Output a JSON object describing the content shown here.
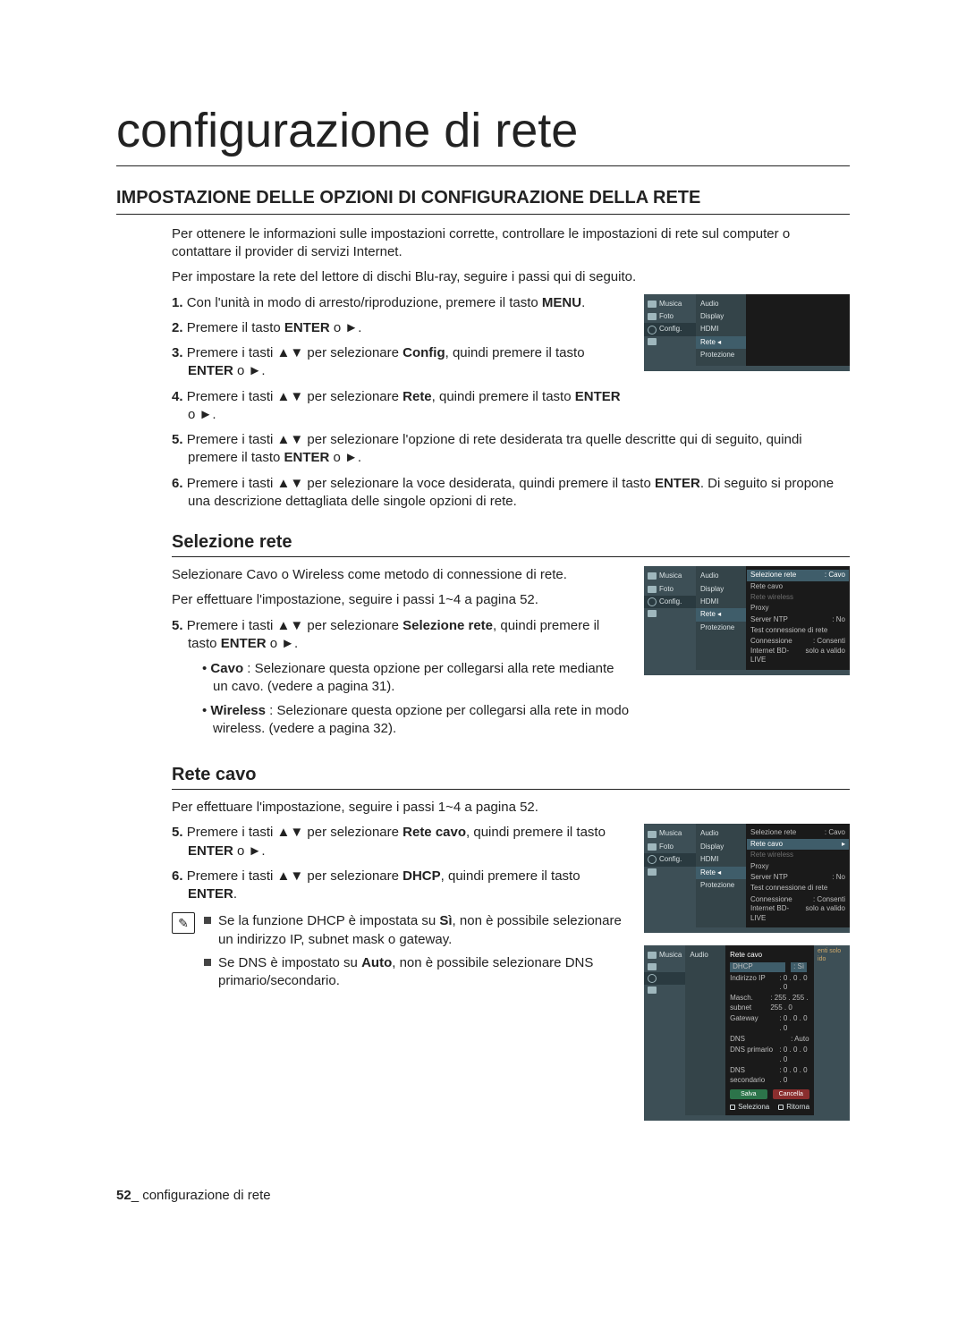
{
  "page_title": "configurazione di rete",
  "main_heading": "IMPOSTAZIONE DELLE OPZIONI DI CONFIGURAZIONE DELLA RETE",
  "intro_p1": "Per ottenere le informazioni sulle impostazioni corrette, controllare le impostazioni di rete sul computer o contattare il provider di servizi Internet.",
  "intro_p2": "Per impostare la rete del lettore di dischi Blu-ray, seguire i passi qui di seguito.",
  "steps_a": {
    "s1_a": "Con l'unità in modo di arresto/riproduzione, premere il tasto ",
    "s1_b": "MENU",
    "s1_c": ".",
    "s2_a": "Premere il tasto ",
    "s2_b": "ENTER",
    "s2_c": " o ►.",
    "s3_a": "Premere i tasti ▲▼ per selezionare ",
    "s3_b": "Config",
    "s3_c": ", quindi premere il tasto ",
    "s3_d": "ENTER",
    "s3_e": " o ►.",
    "s4_a": "Premere i tasti ▲▼ per selezionare ",
    "s4_b": "Rete",
    "s4_c": ", quindi premere il tasto ",
    "s4_d": "ENTER",
    "s4_e": " o ►.",
    "s5_a": "Premere i tasti ▲▼ per selezionare l'opzione di rete desiderata tra quelle descritte qui di seguito, quindi premere il tasto ",
    "s5_b": "ENTER",
    "s5_c": " o ►.",
    "s6_a": "Premere i tasti ▲▼ per selezionare la voce desiderata, quindi premere il tasto ",
    "s6_b": "ENTER",
    "s6_c": ". Di seguito si propone una descrizione dettagliata delle singole opzioni di rete."
  },
  "sel_heading": "Selezione rete",
  "sel_p1": "Selezionare Cavo o Wireless come metodo di connessione di rete.",
  "sel_p2": "Per effettuare l'impostazione, seguire i passi 1~4 a pagina 52.",
  "sel_step5_a": "Premere i tasti ▲▼ per selezionare ",
  "sel_step5_b": "Selezione rete",
  "sel_step5_c": ", quindi premere il tasto ",
  "sel_step5_d": "ENTER",
  "sel_step5_e": " o ►.",
  "sel_b1_a": "Cavo",
  "sel_b1_b": " : Selezionare questa opzione per collegarsi alla rete mediante un cavo. (vedere a pagina 31).",
  "sel_b2_a": "Wireless",
  "sel_b2_b": " : Selezionare questa opzione per collegarsi alla rete in modo wireless. (vedere a pagina 32).",
  "cavo_heading": "Rete cavo",
  "cavo_p1": "Per effettuare l'impostazione, seguire i passi 1~4 a pagina 52.",
  "cavo_s5_a": "Premere i tasti ▲▼ per selezionare ",
  "cavo_s5_b": "Rete cavo",
  "cavo_s5_c": ", quindi premere il tasto ",
  "cavo_s5_d": "ENTER",
  "cavo_s5_e": " o ►.",
  "cavo_s6_a": "Premere i tasti ▲▼ per selezionare ",
  "cavo_s6_b": "DHCP",
  "cavo_s6_c": ", quindi premere il tasto ",
  "cavo_s6_d": "ENTER",
  "cavo_s6_e": ".",
  "note1_a": "Se la funzione DHCP è impostata su ",
  "note1_b": "Sì",
  "note1_c": ", non è possibile selezionare un indirizzo IP, subnet mask o gateway.",
  "note2_a": "Se DNS è impostato su ",
  "note2_b": "Auto",
  "note2_c": ", non è possibile selezionare DNS primario/secondario.",
  "footer_page": "52",
  "footer_text": "_ configurazione di rete",
  "shot_sidebar": {
    "music": "Musica",
    "photo": "Foto",
    "config": "Config."
  },
  "shot_mid": {
    "audio": "Audio",
    "display": "Display",
    "hdmi": "HDMI",
    "rete": "Rete",
    "protezione": "Protezione"
  },
  "shot1_side_note": "",
  "shot2_right": {
    "sel_rete": "Selezione rete",
    "sel_rete_val": ": Cavo",
    "rete_cavo": "Rete cavo",
    "rete_wireless": "Rete wireless",
    "proxy": "Proxy",
    "server_ntp": "Server NTP",
    "server_ntp_val": ": No",
    "test": "Test connessione di rete",
    "conn_bd": "Connessione Internet BD-LIVE",
    "conn_bd_val": ": Consenti solo a valido"
  },
  "shot3_right": {
    "sel_rete": "Selezione rete",
    "sel_rete_val": ": Cavo",
    "rete_cavo": "Rete cavo",
    "rete_wireless": "Rete wireless",
    "proxy": "Proxy",
    "server_ntp": "Server NTP",
    "server_ntp_val": ": No",
    "test": "Test connessione di rete",
    "conn_bd": "Connessione Internet BD-LIVE",
    "conn_bd_val": ": Consenti solo a valido"
  },
  "shot4_right": {
    "title": "Rete cavo",
    "dhcp": "DHCP",
    "dhcp_val": ": Sì",
    "ip": "Indirizzo IP",
    "ip_val": ": 0 . 0 . 0 . 0",
    "mask": "Masch. subnet",
    "mask_val": ": 255 . 255 . 255 . 0",
    "gw": "Gateway",
    "gw_val": ": 0 . 0 . 0 . 0",
    "dns": "DNS",
    "dns_val": ": Auto",
    "dns1": "DNS primario",
    "dns1_val": ": 0 . 0 . 0 . 0",
    "dns2": "DNS secondario",
    "dns2_val": ": 0 . 0 . 0 . 0",
    "btn_save": "Salva",
    "btn_cancel": "Cancella",
    "foot_sel": "Seleziona",
    "foot_ret": "Ritorna",
    "side_note": "enti solo ido"
  }
}
